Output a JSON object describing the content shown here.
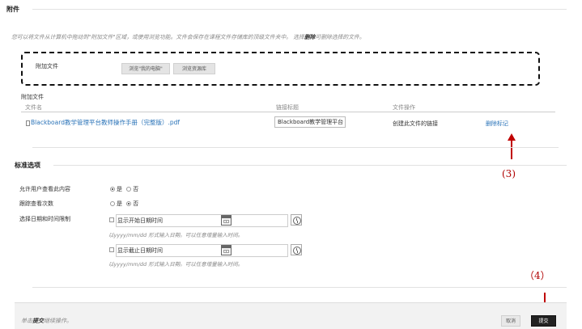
{
  "attachments": {
    "title": "附件",
    "instructions_plain1": "您可以将文件从计算机中拖动到\"附加文件\"区域，或使用浏览功能。文件会保存在课程文件存储库的顶级文件夹中。 选择",
    "instructions_bold": "删除",
    "instructions_plain2": "可删除选择的文件。",
    "attach_label": "附加文件",
    "browse_local_label": "浏览\"我的电脑\"",
    "browse_repo_label": "浏览资源库",
    "attached_heading": "附加文件",
    "columns": {
      "file_name": "文件名",
      "link_title": "链接标题",
      "file_action": "文件操作"
    },
    "file": {
      "name": "Blackboard教学管理平台教师操作手册（完整版）.pdf",
      "link_title_value": "Blackboard教学管理平台",
      "action": "创建此文件的链接",
      "remove": "删除标记"
    }
  },
  "standard_options": {
    "title": "标准选项",
    "permit_view": {
      "label": "允许用户查看此内容",
      "yes": "是",
      "no": "否",
      "selected": "yes"
    },
    "track_views": {
      "label": "跟踪查看次数",
      "yes": "是",
      "no": "否",
      "selected": "no"
    },
    "date_restrictions": {
      "label": "选择日期和时间限制",
      "start_label": "显示开始日期时间",
      "end_label": "显示截止日期时间",
      "hint": "以yyyy/mm/dd 形式输入日期。可以任意增量输入时间。"
    }
  },
  "annotations": {
    "step3": "(3)",
    "step4": "（4）"
  },
  "footer": {
    "text_plain1": "单击",
    "text_bold": "提交",
    "text_plain2": "继续操作。",
    "cancel_label": "取消",
    "submit_label": "提交"
  },
  "colors": {
    "link": "#2a73b8",
    "annotation": "#c00000",
    "submit_bg": "#222222"
  }
}
